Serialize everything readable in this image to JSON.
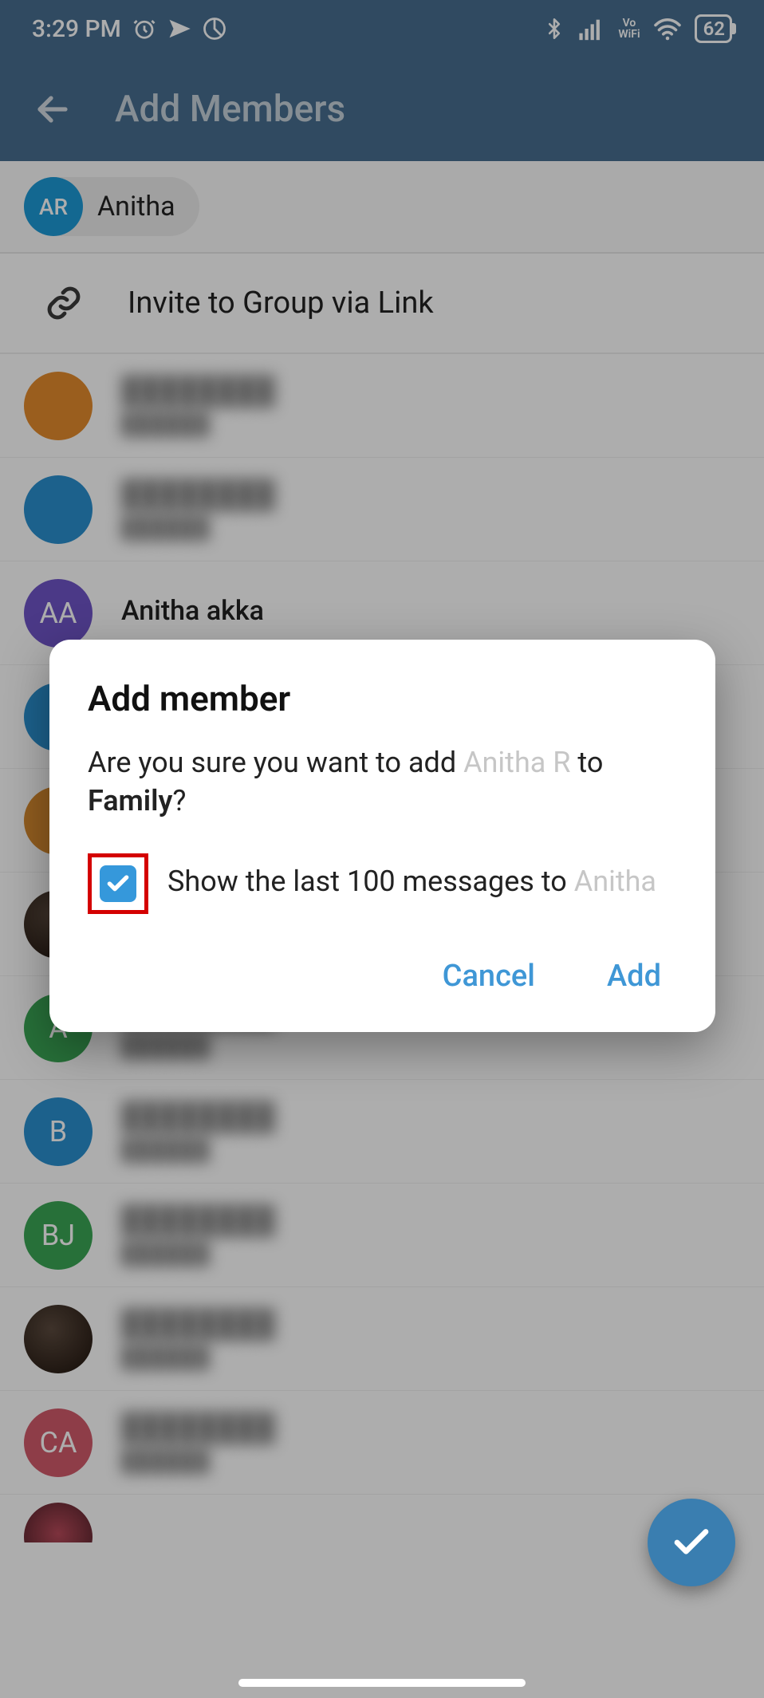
{
  "status": {
    "time": "3:29 PM",
    "vo": "Vo",
    "wifi": "WiFi",
    "battery": "62"
  },
  "appbar": {
    "title": "Add Members"
  },
  "chip": {
    "initials": "AR",
    "label": "Anitha"
  },
  "invite": {
    "label": "Invite to Group via Link"
  },
  "contacts": [
    {
      "initials": "",
      "name": "",
      "status": "",
      "bg": "#e38b2d",
      "redacted": true
    },
    {
      "initials": "",
      "name": "",
      "status": "",
      "bg": "#2a8fcf",
      "redacted": true
    },
    {
      "initials": "AA",
      "name": "Anitha akka",
      "status": "",
      "bg": "#6f54c7",
      "redacted": false
    },
    {
      "initials": "",
      "name": "",
      "status": "",
      "bg": "#2a8fcf",
      "redacted": true
    },
    {
      "initials": "",
      "name": "",
      "status": "",
      "bg": "#d68a2f",
      "redacted": true
    },
    {
      "initials": "",
      "name": "",
      "status": "",
      "bg": "photo",
      "redacted": true
    },
    {
      "initials": "A",
      "name": "",
      "status": "",
      "bg": "#3aa655",
      "redacted": true
    },
    {
      "initials": "B",
      "name": "",
      "status": "",
      "bg": "#2a8fcf",
      "redacted": true
    },
    {
      "initials": "BJ",
      "name": "",
      "status": "",
      "bg": "#3aa655",
      "redacted": true
    },
    {
      "initials": "",
      "name": "",
      "status": "",
      "bg": "photo",
      "redacted": true
    },
    {
      "initials": "CA",
      "name": "",
      "status": "",
      "bg": "#d15a6a",
      "redacted": true
    }
  ],
  "dialog": {
    "title": "Add member",
    "body_prefix": "Are you sure you want to add ",
    "body_user": "Anitha R",
    "body_mid": " to ",
    "body_group": "Family",
    "body_suffix": "?",
    "checkbox_prefix": "Show the last 100 messages to ",
    "checkbox_user": "Anitha",
    "cancel": "Cancel",
    "add": "Add"
  }
}
